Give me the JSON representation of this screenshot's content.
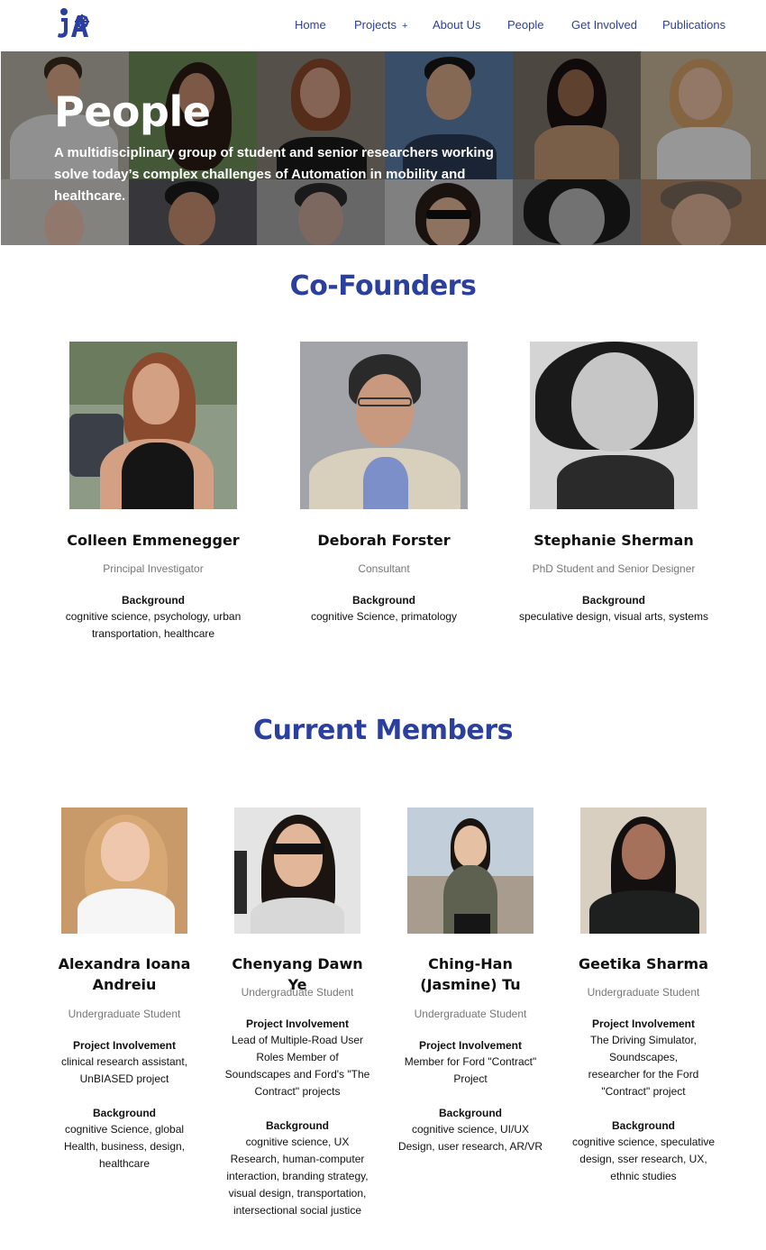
{
  "nav": {
    "links": [
      "Home",
      "Projects",
      "About Us",
      "People",
      "Get Involved",
      "Publications"
    ],
    "projects_plus": "+"
  },
  "hero": {
    "title": "People",
    "subtitle": "A multidisciplinary group of student and senior researchers working solve today’s complex challenges of Automation in mobility and healthcare."
  },
  "cofounders": {
    "title": "Co-Founders",
    "background_label": "Background",
    "people": [
      {
        "name": "Colleen Emmenegger",
        "role": "Principal Investigator",
        "background": "cognitive science, psychology, urban transportation, healthcare"
      },
      {
        "name": "Deborah Forster",
        "role": "Consultant",
        "background": "cognitive Science, primatology"
      },
      {
        "name": "Stephanie Sherman",
        "role": "PhD Student and Senior Designer",
        "background": "speculative design, visual arts, systems"
      }
    ]
  },
  "members": {
    "title": "Current Members",
    "involvement_label": "Project Involvement",
    "background_label": "Background",
    "people": [
      {
        "name": "Alexandra Ioana Andreiu",
        "role": "Undergraduate Student",
        "involvement": "clinical research assistant, UnBIASED project",
        "background": "cognitive Science, global Health, business, design, healthcare"
      },
      {
        "name": "Chenyang Dawn Ye",
        "role": "Undergraduate Student",
        "involvement": "Lead of Multiple-Road User Roles Member of Soundscapes and Ford's \"The Contract\" projects",
        "background": "cognitive science, UX Research, human-computer interaction, branding strategy, visual design, transportation, intersectional social justice"
      },
      {
        "name": "Ching-Han (Jasmine) Tu",
        "role": "Undergraduate Student",
        "involvement": "Member for Ford \"Contract\" Project",
        "background": "cognitive science, UI/UX Design, user research, AR/VR"
      },
      {
        "name": "Geetika Sharma",
        "role": "Undergraduate Student",
        "involvement": "The Driving Simulator, Soundscapes, researcher for the Ford \"Contract\" project",
        "background": "cognitive science, speculative design, sser research, UX, ethnic studies"
      }
    ]
  },
  "colors": {
    "brand_blue": "#2b3f9f",
    "muted_text": "#777777"
  }
}
